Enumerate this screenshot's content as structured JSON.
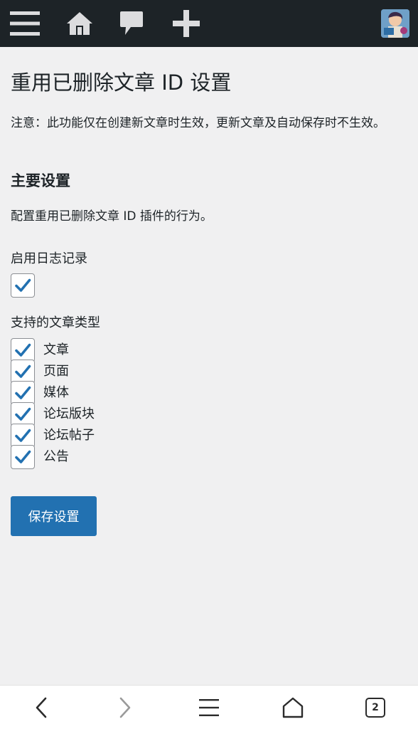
{
  "topbar": {
    "icons": [
      "menu-icon",
      "home-icon",
      "comment-icon",
      "plus-icon",
      "avatar"
    ],
    "background": "#1d2327"
  },
  "page": {
    "title": "重用已删除文章 ID 设置",
    "notice": "注意：此功能仅在创建新文章时生效，更新文章及自动保存时不生效。"
  },
  "section": {
    "title": "主要设置",
    "description": "配置重用已删除文章 ID 插件的行为。"
  },
  "fields": {
    "log_label": "启用日志记录",
    "log_checked": true,
    "types_label": "支持的文章类型",
    "types": [
      {
        "label": "文章",
        "checked": true
      },
      {
        "label": "页面",
        "checked": true
      },
      {
        "label": "媒体",
        "checked": true
      },
      {
        "label": "论坛版块",
        "checked": true
      },
      {
        "label": "论坛帖子",
        "checked": true
      },
      {
        "label": "公告",
        "checked": true
      }
    ]
  },
  "actions": {
    "save_label": "保存设置",
    "accent": "#2271b1"
  },
  "browser": {
    "tab_count": "2",
    "icons": [
      "back-icon",
      "forward-icon",
      "menu-icon",
      "home-icon",
      "tabs-icon"
    ]
  }
}
